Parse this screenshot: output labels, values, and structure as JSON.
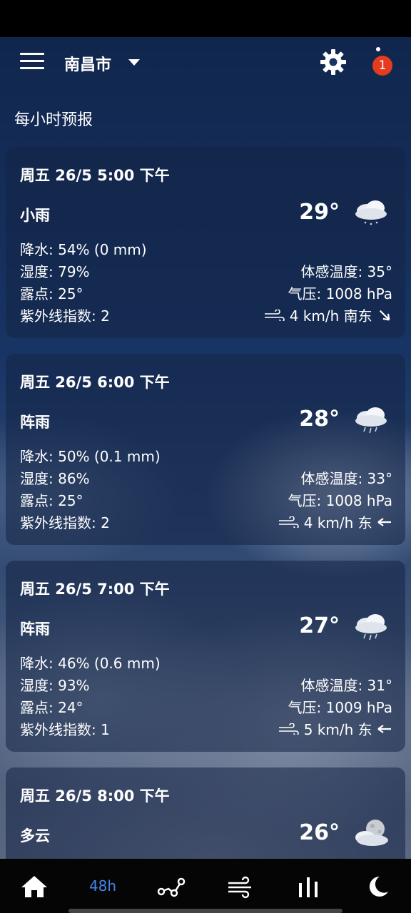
{
  "header": {
    "city": "南昌市"
  },
  "notification_count": "1",
  "section_title": "每小时预报",
  "forecasts": [
    {
      "time": "周五 26/5  5:00 下午",
      "condition": "小雨",
      "temperature": "29°",
      "icon": "light-rain-icon",
      "precipitation": "降水: 54% (0 mm)",
      "humidity": "湿度: 79%",
      "dew_point": "露点: 25°",
      "uv_index": "紫外线指数: 2",
      "feels_like": "体感温度: 35°",
      "pressure": "气压: 1008 hPa",
      "wind": "4 km/h 南东"
    },
    {
      "time": "周五 26/5  6:00 下午",
      "condition": "阵雨",
      "temperature": "28°",
      "icon": "showers-icon",
      "precipitation": "降水: 50% (0.1 mm)",
      "humidity": "湿度: 86%",
      "dew_point": "露点: 25°",
      "uv_index": "紫外线指数: 2",
      "feels_like": "体感温度: 33°",
      "pressure": "气压: 1008 hPa",
      "wind": "4 km/h 东"
    },
    {
      "time": "周五 26/5  7:00 下午",
      "condition": "阵雨",
      "temperature": "27°",
      "icon": "showers-icon",
      "precipitation": "降水: 46% (0.6 mm)",
      "humidity": "湿度: 93%",
      "dew_point": "露点: 24°",
      "uv_index": "紫外线指数: 1",
      "feels_like": "体感温度: 31°",
      "pressure": "气压: 1009 hPa",
      "wind": "5 km/h 东"
    },
    {
      "time": "周五 26/5  8:00 下午",
      "condition": "多云",
      "temperature": "26°",
      "icon": "cloudy-night-icon"
    }
  ],
  "nav": {
    "hourly_label": "48h",
    "accent_color": "#3f87e8"
  }
}
